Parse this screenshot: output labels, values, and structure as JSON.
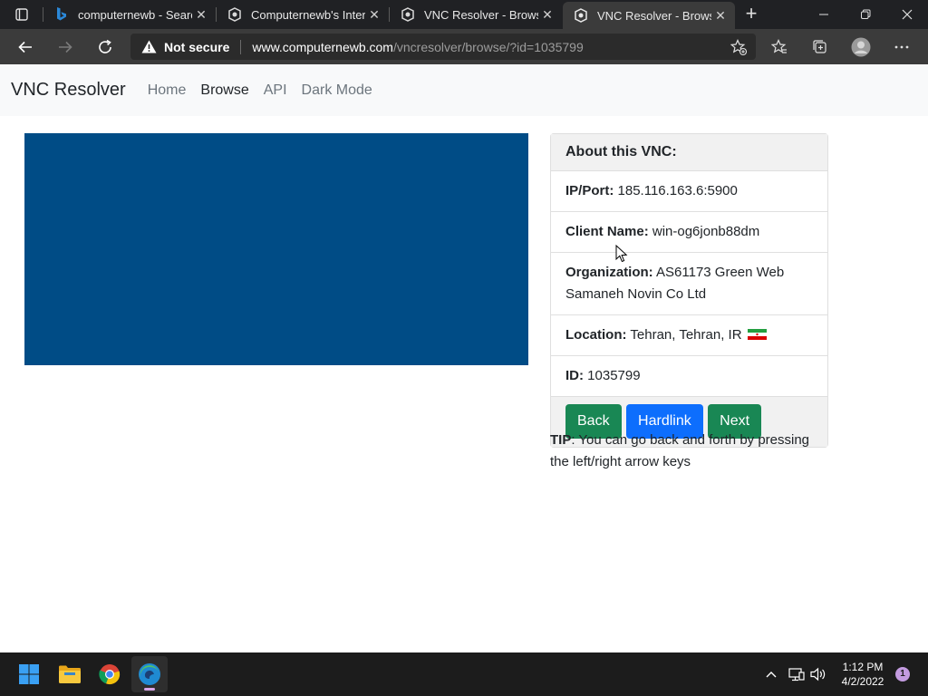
{
  "browser": {
    "tabs": [
      {
        "title": "computernewb - Search",
        "icon": "bing-icon",
        "active": false
      },
      {
        "title": "Computernewb's Internet",
        "icon": "vnc-resolver-icon",
        "active": false
      },
      {
        "title": "VNC Resolver - Browse",
        "icon": "vnc-resolver-icon",
        "active": false
      },
      {
        "title": "VNC Resolver - Browse",
        "icon": "vnc-resolver-icon",
        "active": true
      }
    ],
    "address": {
      "security_label": "Not secure",
      "host": "www.computernewb.com",
      "path": "/vncresolver/browse/?id=1035799"
    }
  },
  "site": {
    "brand": "VNC Resolver",
    "nav": [
      "Home",
      "Browse",
      "API",
      "Dark Mode"
    ],
    "active_nav": "Browse"
  },
  "vnc": {
    "screenshot_color": "#004c86",
    "card_title": "About this VNC:",
    "ip_label": "IP/Port:",
    "ip_value": "185.116.163.6:5900",
    "client_label": "Client Name:",
    "client_value": "win-og6jonb88dm",
    "org_label": "Organization:",
    "org_value": "AS61173 Green Web Samaneh Novin Co Ltd",
    "location_label": "Location:",
    "location_value": "Tehran, Tehran, IR",
    "id_label": "ID:",
    "id_value": "1035799",
    "buttons": {
      "back": "Back",
      "hardlink": "Hardlink",
      "next": "Next"
    },
    "tip_label": "TIP",
    "tip_text": ": You can go back and forth by pressing the left/right arrow keys"
  },
  "colors": {
    "green": "#198754",
    "blue": "#0d6efd"
  },
  "taskbar": {
    "apps": [
      "start-icon",
      "file-explorer-icon",
      "chrome-icon",
      "edge-icon"
    ],
    "time": "1:12 PM",
    "date": "4/2/2022",
    "notifications": "1"
  }
}
